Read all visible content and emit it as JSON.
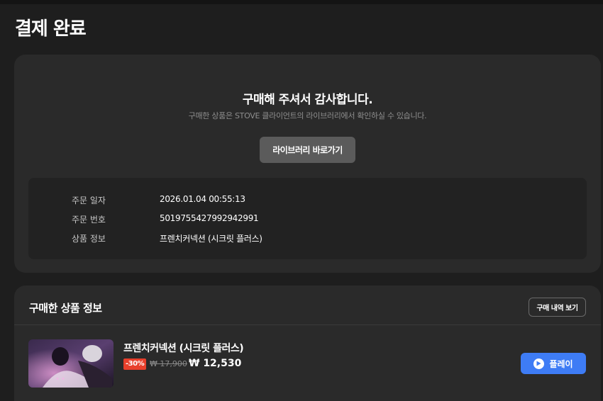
{
  "page": {
    "title": "결제 완료"
  },
  "confirmation": {
    "heading": "구매해 주셔서 감사합니다.",
    "subtext": "구매한 상품은 STOVE 클라이언트의 라이브러리에서 확인하실 수 있습니다.",
    "library_button": "라이브러리 바로가기"
  },
  "order_info": [
    {
      "label": "주문 일자",
      "value": "2026.01.04 00:55:13"
    },
    {
      "label": "주문 번호",
      "value": "5019755427992942991"
    },
    {
      "label": "상품 정보",
      "value": "프렌치커넥션 (시크릿 플러스)"
    }
  ],
  "purchased": {
    "section_title": "구매한 상품 정보",
    "history_button": "구매 내역 보기",
    "product": {
      "name": "프렌치커넥션 (시크릿 플러스)",
      "discount": "-30%",
      "original_price": "₩ 17,900",
      "sale_price": "₩ 12,530",
      "play_label": "플레이",
      "thumbnail_icon": "game-thumbnail-image"
    }
  },
  "colors": {
    "background": "#1e1e1e",
    "card": "#2a2a2a",
    "accent_blue": "#3e7cf5",
    "discount_red": "#e8402c"
  }
}
